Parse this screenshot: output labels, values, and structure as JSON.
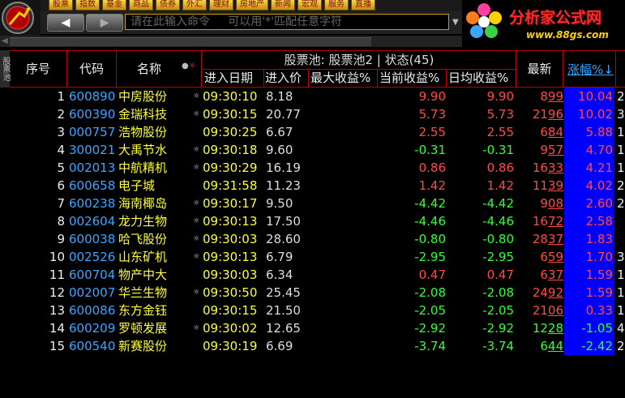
{
  "menu": [
    "股票",
    "指数",
    "基金",
    "商品",
    "债券",
    "外汇",
    "理财",
    "房地产",
    "新闻",
    "宏观",
    "服务",
    "直播"
  ],
  "nav": {
    "back": "◀",
    "forward": "▶"
  },
  "command": {
    "placeholder": "请在此输入命令     可以用'*'匹配任意字符"
  },
  "brand": {
    "name": "分析家公式网",
    "url": "www.88gs.com"
  },
  "side_tab": "股票池",
  "columns": {
    "index": "序号",
    "code": "代码",
    "name": "名称",
    "pool_title": "股票池: 股票池2 | 状态(45)",
    "entry_date": "进入日期",
    "entry_price": "进入价",
    "max_gain": "最大收益%",
    "current_gain": "当前收益%",
    "daily_avg_gain": "日均收益%",
    "latest": "最新",
    "change_pct": "涨幅%↓"
  },
  "colors": {
    "up": "#ff4a4a",
    "down": "#33ff33",
    "code": "#3aa6ff",
    "name": "#ffff33",
    "divider": "#bb0000",
    "highlight": "#0000ff"
  },
  "rows": [
    {
      "idx": "1",
      "code": "600890",
      "name": "中房股份",
      "flag": true,
      "time": "09:30:10",
      "price": "8.18",
      "max": "9.90",
      "cur": "9.90",
      "lat_a": "8",
      "lat_b": "99",
      "chg": "10.04",
      "edge": "2"
    },
    {
      "idx": "2",
      "code": "600390",
      "name": "金瑞科技",
      "flag": true,
      "time": "09:30:15",
      "price": "20.77",
      "max": "5.73",
      "cur": "5.73",
      "lat_a": "21",
      "lat_b": "96",
      "chg": "10.02",
      "edge": "3"
    },
    {
      "idx": "3",
      "code": "000757",
      "name": "浩物股份",
      "flag": false,
      "time": "09:30:25",
      "price": "6.67",
      "max": "2.55",
      "cur": "2.55",
      "lat_a": "6",
      "lat_b": "84",
      "chg": "5.88",
      "edge": "1"
    },
    {
      "idx": "4",
      "code": "300021",
      "name": "大禹节水",
      "flag": true,
      "time": "09:30:18",
      "price": "9.60",
      "max": "-0.31",
      "cur": "-0.31",
      "lat_a": "9",
      "lat_b": "57",
      "chg": "4.70",
      "edge": "1"
    },
    {
      "idx": "5",
      "code": "002013",
      "name": "中航精机",
      "flag": true,
      "time": "09:30:29",
      "price": "16.19",
      "max": "0.86",
      "cur": "0.86",
      "lat_a": "16",
      "lat_b": "33",
      "chg": "4.21",
      "edge": "1"
    },
    {
      "idx": "6",
      "code": "600658",
      "name": "电子城",
      "flag": false,
      "time": "09:31:58",
      "price": "11.23",
      "max": "1.42",
      "cur": "1.42",
      "lat_a": "11",
      "lat_b": "39",
      "chg": "4.02",
      "edge": "2"
    },
    {
      "idx": "7",
      "code": "600238",
      "name": "海南椰岛",
      "flag": true,
      "time": "09:30:17",
      "price": "9.50",
      "max": "-4.42",
      "cur": "-4.42",
      "lat_a": "9",
      "lat_b": "08",
      "chg": "2.60",
      "edge": "2"
    },
    {
      "idx": "8",
      "code": "002604",
      "name": "龙力生物",
      "flag": true,
      "time": "09:30:13",
      "price": "17.50",
      "max": "-4.46",
      "cur": "-4.46",
      "lat_a": "16",
      "lat_b": "72",
      "chg": "2.58",
      "edge": ""
    },
    {
      "idx": "9",
      "code": "600038",
      "name": "哈飞股份",
      "flag": true,
      "time": "09:30:03",
      "price": "28.60",
      "max": "-0.80",
      "cur": "-0.80",
      "lat_a": "28",
      "lat_b": "37",
      "chg": "1.83",
      "edge": ""
    },
    {
      "idx": "10",
      "code": "002526",
      "name": "山东矿机",
      "flag": true,
      "time": "09:30:13",
      "price": "6.79",
      "max": "-2.95",
      "cur": "-2.95",
      "lat_a": "6",
      "lat_b": "59",
      "chg": "1.70",
      "edge": "3"
    },
    {
      "idx": "11",
      "code": "600704",
      "name": "物产中大",
      "flag": false,
      "time": "09:30:03",
      "price": "6.34",
      "max": "0.47",
      "cur": "0.47",
      "lat_a": "6",
      "lat_b": "37",
      "chg": "1.59",
      "edge": "1"
    },
    {
      "idx": "12",
      "code": "002007",
      "name": "华兰生物",
      "flag": true,
      "time": "09:30:50",
      "price": "25.45",
      "max": "-2.08",
      "cur": "-2.08",
      "lat_a": "24",
      "lat_b": "92",
      "chg": "1.59",
      "edge": "1"
    },
    {
      "idx": "13",
      "code": "600086",
      "name": "东方金钰",
      "flag": false,
      "time": "09:30:15",
      "price": "21.50",
      "max": "-2.05",
      "cur": "-2.05",
      "lat_a": "21",
      "lat_b": "06",
      "chg": "0.33",
      "edge": "1"
    },
    {
      "idx": "14",
      "code": "600209",
      "name": "罗顿发展",
      "flag": true,
      "time": "09:30:02",
      "price": "12.65",
      "max": "-2.92",
      "cur": "-2.92",
      "lat_a": "12",
      "lat_b": "28",
      "chg": "-1.05",
      "edge": "4"
    },
    {
      "idx": "15",
      "code": "600540",
      "name": "新赛股份",
      "flag": false,
      "time": "09:30:19",
      "price": "6.69",
      "max": "-3.74",
      "cur": "-3.74",
      "lat_a": "6",
      "lat_b": "44",
      "chg": "-2.42",
      "edge": "2"
    }
  ]
}
